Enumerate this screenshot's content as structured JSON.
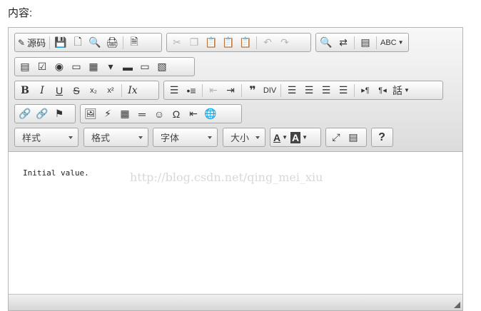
{
  "page": {
    "field_label": "内容:"
  },
  "toolbar": {
    "source_label": "源码",
    "combos": {
      "styles": "样式",
      "format": "格式",
      "font": "字体",
      "size": "大小"
    },
    "glyphs": {
      "bold": "B",
      "italic": "I",
      "underline": "U",
      "strike": "S",
      "subscript": "x₂",
      "superscript": "x²",
      "remove_format": "Ix",
      "blockquote": "❞",
      "div": "DIV",
      "omega": "Ω",
      "rtl_para": "¶◂",
      "ltr_para": "▸¶",
      "language": "話",
      "help": "?",
      "text_color": "A",
      "bg_color": "A",
      "spellcheck": "ABC"
    }
  },
  "content": {
    "initial_text": "Initial value.",
    "watermark": "http://blog.csdn.net/qing_mei_xiu"
  },
  "colors": {
    "toolbar_top": "#f8f8f8",
    "toolbar_bottom": "#dcdcdc",
    "border": "#b6b6b6"
  }
}
